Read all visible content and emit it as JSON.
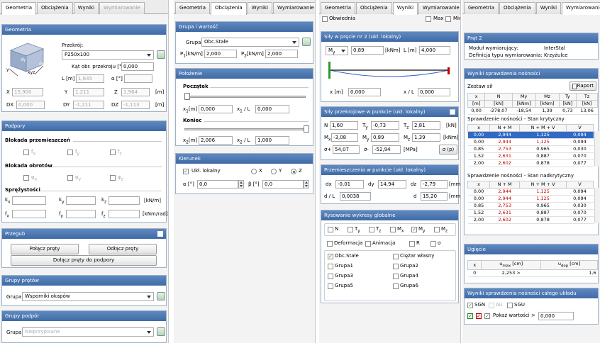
{
  "panel1": {
    "tabs": [
      "Geometria",
      "Obciążenia",
      "Wyniki",
      "Wymiarowanie"
    ],
    "geometria": {
      "header": "Geometria",
      "przekroj_label": "Przekrój:",
      "przekroj_value": "P250x100",
      "kat_label": "Kąt obr. przekroju [°]",
      "kat_value": "0,000",
      "axis_y": "y",
      "axis_xyz": "xyz",
      "axis_dy": "dy",
      "axis_dx": "dx",
      "L_label": "L [m]",
      "L_value": "1,645",
      "a_label": "α [°]",
      "a_value": "",
      "X_label": "X",
      "X_value": "15,900",
      "Y_label": "Y",
      "Y_value": "1,211",
      "Z_label": "Z",
      "Z_value": "1,964",
      "unit_m": "[m]",
      "DX_label": "DX",
      "DX_value": "0,000",
      "DY_label": "DY",
      "DY_value": "-1,211",
      "DZ_label": "DZ",
      "DZ_value": "-1,113",
      "unit_m2": "[m]"
    },
    "podpory": {
      "header": "Podpory",
      "blokada_przem": "Blokada przemieszczeń",
      "fx": "f",
      "fy": "f",
      "fz": "f",
      "sx": "x",
      "sy": "y",
      "sz": "z",
      "blokada_obr": "Blokada obrotów",
      "phix": "φ",
      "phiy": "φ",
      "phiz": "φ",
      "sprezystosci": "Sprężystości",
      "kx": "k",
      "ky": "k",
      "kz": "k",
      "unit_k": "[kN/m]",
      "fxx": "f",
      "fyy": "f",
      "fzz": "f",
      "unit_f": "[kNm/rad]"
    },
    "przegub": {
      "header": "Przegub",
      "polacz": "Połącz pręty",
      "odlacz": "Odłącz pręty",
      "dolacz": "Dołącz pręty do podpory"
    },
    "grupy_pretow": {
      "header": "Grupy prętów",
      "label": "Grupa",
      "value": "Wsporniki okapów"
    },
    "grupy_podpor": {
      "header": "Grupy podpór",
      "label": "Grupa",
      "value": "Nieprzypisane"
    }
  },
  "panel2": {
    "tabs": [
      "Geometria",
      "Obciążenia",
      "Wyniki",
      "Wymiarowanie"
    ],
    "grupa": {
      "header": "Grupa i wartość",
      "grupa_label": "Grupa",
      "grupa_value": "Obc.Stałe",
      "p1_label": "P",
      "p1_sub": "1",
      "p1_unit": "[kN/m]",
      "p1_value": "2,000",
      "p2_label": "P",
      "p2_sub": "2",
      "p2_unit": "[kN/m]",
      "p2_value": "2,000"
    },
    "polozenie": {
      "header": "Położenie",
      "poczatek": "Początek",
      "x1_label": "x",
      "x1_sub": "1",
      "x1_unit": "[m]",
      "x1_value": "0,000",
      "x1L_label": "x",
      "x1L_sub": "1",
      "x1L_tail": " / L",
      "x1L_value": "0,000",
      "koniec": "Koniec",
      "x2_label": "x",
      "x2_sub": "2",
      "x2_unit": "[m]",
      "x2_value": "2,006",
      "x2L_label": "x",
      "x2L_sub": "2",
      "x2L_tail": " / L",
      "x2L_value": "1,000"
    },
    "kierunek": {
      "header": "Kierunek",
      "ukl": "Ukł. lokalny",
      "rx": "X",
      "ry": "Y",
      "rz": "Z",
      "a_label": "α [°]",
      "a_value": "0,0",
      "b_label": "β [°]",
      "b_value": "0,0"
    }
  },
  "panel3": {
    "tabs": [
      "Geometria",
      "Obciążenia",
      "Wyniki",
      "Wymiarowanie"
    ],
    "obwiednia": "Obwiednia",
    "max": "Max",
    "min": "Min",
    "sily": {
      "header": "Siły w pręcie nr 2 (ukł. lokalny)",
      "sel": "M",
      "sel_sub": "y",
      "value": "0,89",
      "unit": "[kNm]",
      "L_label": "L [m]",
      "L_value": "4,000",
      "x_label": "x [m]",
      "x_value": "0,000",
      "xL_label": "x / L",
      "xL_value": "0,000"
    },
    "przekroj": {
      "header": "Siły przekrojowe w punkcie (ukł. lokalny)",
      "N_label": "N",
      "N_value": "1,60",
      "Ty_label": "T",
      "Ty_sub": "y",
      "Ty_value": "-0,73",
      "Tz_label": "T",
      "Tz_sub": "z",
      "Tz_value": "2,81",
      "unit_kN": "[kN]",
      "Mx_label": "M",
      "Mx_sub": "x",
      "Mx_value": "-3,08",
      "My_label": "M",
      "My_sub": "y",
      "My_value": "0,89",
      "Mz_label": "M",
      "Mz_sub": "z",
      "Mz_value": "1,39",
      "unit_kNm": "[kNm]",
      "s1_label": "σ+",
      "s1_value": "54,07",
      "s2_label": "σ-",
      "s2_value": "-52,94",
      "unit_MPa": "[MPa]",
      "sp": "σ (p)"
    },
    "przem": {
      "header": "Przemieszczenia w punkcie (ukł. lokalny)",
      "dx_label": "dx",
      "dx_value": "-0,01",
      "dy_label": "dy",
      "dy_value": "14,94",
      "dz_label": "dz",
      "dz_value": "-2,79",
      "unit_mm": "[mm]",
      "dL_label": "d / L",
      "dL_value": "0,0038",
      "d_label": "d",
      "d_value": "15,20",
      "unit_mm2": "[mm]"
    },
    "rysowanie": {
      "header": "Rysowanie wykresy globalne",
      "c_N": "N",
      "c_Ty": "T",
      "c_Ty_sub": "y",
      "c_Tz": "T",
      "c_Tz_sub": "z",
      "c_Mx": "M",
      "c_Mx_sub": "x",
      "c_My": "M",
      "c_My_sub": "y",
      "c_Mz": "M",
      "c_Mz_sub": "z",
      "deformacja": "Deformacja",
      "animacja": "Animacja",
      "R": "R",
      "sigma": "σ",
      "loads": [
        "Obc.Stałe",
        "Ciężar własny",
        "Grupa1",
        "Grupa2",
        "Grupa3",
        "Grupa4",
        "Grupa5",
        "Grupa6"
      ]
    }
  },
  "panel4": {
    "tabs": [
      "Geometria",
      "Obciążenia",
      "Wyniki",
      "Wymiarowanie"
    ],
    "pret": {
      "header": "Pręt 2",
      "modul_label": "Moduł wymiarujący:",
      "modul_value": "InterStal",
      "def_label": "Definicja typu wymiarowania:",
      "def_value": "Krzyżulce"
    },
    "wyniki": {
      "header": "Wyniki sprawdzenia nośności",
      "zestaw": "Zestaw sił",
      "raport": "Raport",
      "sil_head1": [
        "x",
        "N",
        "My",
        "Mz",
        "Ty",
        "Tz"
      ],
      "sil_head2": [
        "[m]",
        "[kN]",
        "[kNm]",
        "[kNm]",
        "[kN]",
        "[kN]"
      ],
      "sil_row": [
        "0,00",
        "-278,07",
        "-18,54",
        "1,39",
        "0,73",
        "13,06"
      ],
      "kryt_title": "Sprawdzenie nośności - Stan krytyczny",
      "kryt_head": [
        "x",
        "N + M",
        "N + M + V",
        "V"
      ],
      "kryt_rows": [
        [
          "0,00",
          "2,944",
          "1,125",
          "0,094"
        ],
        [
          "0,00",
          "2,944",
          "1,125",
          "0,094"
        ],
        [
          "0,85",
          "2,753",
          "0,965",
          "0,030"
        ],
        [
          "1,52",
          "2,631",
          "0,887",
          "0,070"
        ],
        [
          "2,00",
          "2,602",
          "0,878",
          "0,077"
        ]
      ],
      "nad_title": "Sprawdzenie nośności - Stan nadkrytyczny",
      "nad_head": [
        "x",
        "N + M",
        "N + M + V",
        "V"
      ],
      "nad_rows": [
        [
          "0,00",
          "2,944",
          "1,125",
          "0,094"
        ],
        [
          "0,00",
          "2,944",
          "1,125",
          "0,094"
        ],
        [
          "0,85",
          "2,753",
          "0,965",
          "0,030"
        ],
        [
          "1,52",
          "2,631",
          "0,887",
          "0,070"
        ],
        [
          "2,00",
          "2,602",
          "0,878",
          "0,077"
        ]
      ]
    },
    "ugiecie": {
      "header": "Ugięcie",
      "h_x": "x",
      "h_umax": "u",
      "h_umax_sub": "max",
      "h_umax_unit": " [cm]",
      "h_udop": "u",
      "h_udop_sub": "dop",
      "h_udop_unit": " [cm]",
      "x": "0",
      "umax": "2,253 >",
      "udop": "1,6"
    },
    "calosc": {
      "header": "Wyniki sprawdzenia nośności całego układu",
      "sgn": "SGN",
      "au": "Au",
      "sgu": "SGU",
      "pokaz": "Pokaż wartości >",
      "pokaz_value": "0,000"
    }
  },
  "colors": {
    "header_blue": "#4a76b2",
    "accent_red": "#c00000",
    "select_blue": "#316ac5",
    "green": "#2a8a2a"
  }
}
